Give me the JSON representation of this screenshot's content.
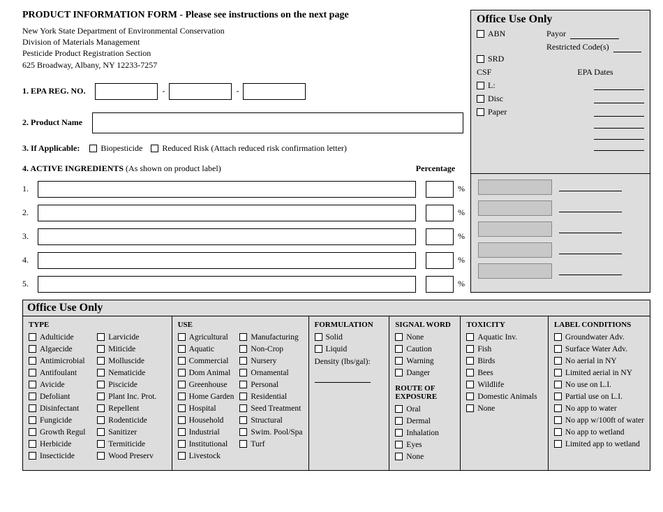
{
  "header": {
    "title": "PRODUCT INFORMATION FORM - Please see instructions on the next page",
    "org1": "New York State Department of Environmental Conservation",
    "org2": "Division of Materials Management",
    "org3": "Pesticide Product Registration Section",
    "org4": "625 Broadway, Albany, NY 12233-7257"
  },
  "fields": {
    "epa_label": "1. EPA REG. NO.",
    "product_label": "2. Product Name",
    "if_applicable_label": "3. If Applicable:",
    "biopesticide": "Biopesticide",
    "reduced_risk": "Reduced Risk (Attach reduced risk confirmation letter)",
    "active_ing_label_b": "4. ACTIVE INGREDIENTS",
    "active_ing_label_r": " (As shown on product label)",
    "percentage_label": "Percentage",
    "pct_symbol": "%"
  },
  "ingredients": [
    "1.",
    "2.",
    "3.",
    "4.",
    "5."
  ],
  "office_right": {
    "title": "Office Use Only",
    "abn": "ABN",
    "payor": "Payor",
    "restricted": "Restricted Code(s)",
    "srd": "SRD",
    "csf": "CSF",
    "epa_dates": "EPA Dates",
    "l": "L:",
    "disc": "Disc",
    "paper": "Paper"
  },
  "bottom": {
    "title": "Office Use Only",
    "type_head": "TYPE",
    "use_head": "USE",
    "formulation_head": "FORMULATION",
    "signal_head": "SIGNAL WORD",
    "route_head": "ROUTE OF EXPOSURE",
    "toxicity_head": "TOXICITY",
    "label_cond_head": "LABEL CONDITIONS",
    "density": "Density (lbs/gal):",
    "type_col1": [
      "Adulticide",
      "Algaecide",
      "Antimicrobial",
      "Antifoulant",
      "Avicide",
      "Defoliant",
      "Disinfectant",
      "Fungicide",
      "Growth Regul",
      "Herbicide",
      "Insecticide"
    ],
    "type_col2": [
      "Larvicide",
      "Miticide",
      "Molluscide",
      "Nematicide",
      "Piscicide",
      "Plant Inc. Prot.",
      "Repellent",
      "Rodenticide",
      "Sanitizer",
      "Termiticide",
      "Wood Preserv"
    ],
    "use_col1": [
      "Agricultural",
      "Aquatic",
      "Commercial",
      "Dom Animal",
      "Greenhouse",
      "Home Garden",
      "Hospital",
      "Household",
      "Industrial",
      "Institutional",
      "Livestock"
    ],
    "use_col2": [
      "Manufacturing",
      "Non-Crop",
      "Nursery",
      "Ornamental",
      "Personal",
      "Residential",
      "Seed Treatment",
      "Structural",
      "Swim. Pool/Spa",
      "Turf"
    ],
    "formulation": [
      "Solid",
      "Liquid"
    ],
    "signal": [
      "None",
      "Caution",
      "Warning",
      "Danger"
    ],
    "route": [
      "Oral",
      "Dermal",
      "Inhalation",
      "Eyes",
      "None"
    ],
    "toxicity": [
      "Aquatic Inv.",
      "Fish",
      "Birds",
      "Bees",
      "Wildlife",
      "Domestic Animals",
      "None"
    ],
    "label_cond": [
      "Groundwater Adv.",
      "Surface Water Adv.",
      "No aerial in NY",
      "Limited aerial in NY",
      "No use on L.I.",
      "Partial use on L.I.",
      "No app to water",
      "No app w/100ft of water",
      "No app to wetland",
      "Limited app to wetland"
    ]
  }
}
